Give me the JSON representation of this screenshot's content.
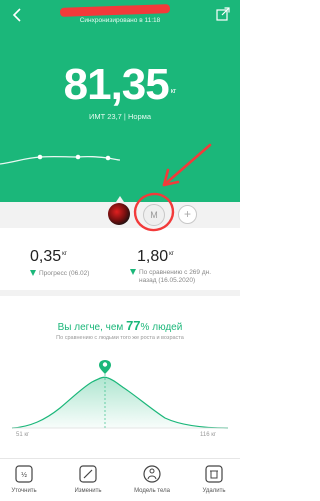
{
  "header": {
    "sync_text": "Синхронизировано в 11:18"
  },
  "measurement": {
    "weight_value": "81,35",
    "weight_unit": "кг",
    "bmi_text": "ИМТ 23,7 | Норма"
  },
  "profiles": {
    "current_initial": "M",
    "add_symbol": "+"
  },
  "stats": {
    "left_value": "0,35",
    "left_unit": "кг",
    "left_note": "Прогресс (06.02)",
    "right_value": "1,80",
    "right_unit": "кг",
    "right_note_line1": "По сравнению с 269 дн.",
    "right_note_line2": "назад (16.05.2020)"
  },
  "comparison": {
    "title_prefix": "Вы легче, чем ",
    "percent": "77",
    "percent_sign": "%",
    "title_suffix": " людей",
    "subtitle": "По сравнению с людьми того же роста и возраста",
    "axis_min": "51 кг",
    "axis_max": "116 кг",
    "user_percentile": 0.77
  },
  "toolbar": {
    "items": [
      {
        "label": "Уточнить",
        "icon": "scale-icon"
      },
      {
        "label": "Изменить",
        "icon": "edit-icon"
      },
      {
        "label": "Модель тела",
        "icon": "body-model-icon"
      },
      {
        "label": "Удалить",
        "icon": "trash-icon"
      }
    ]
  },
  "colors": {
    "accent": "#1bb77a",
    "annotation": "#f23a3a"
  }
}
